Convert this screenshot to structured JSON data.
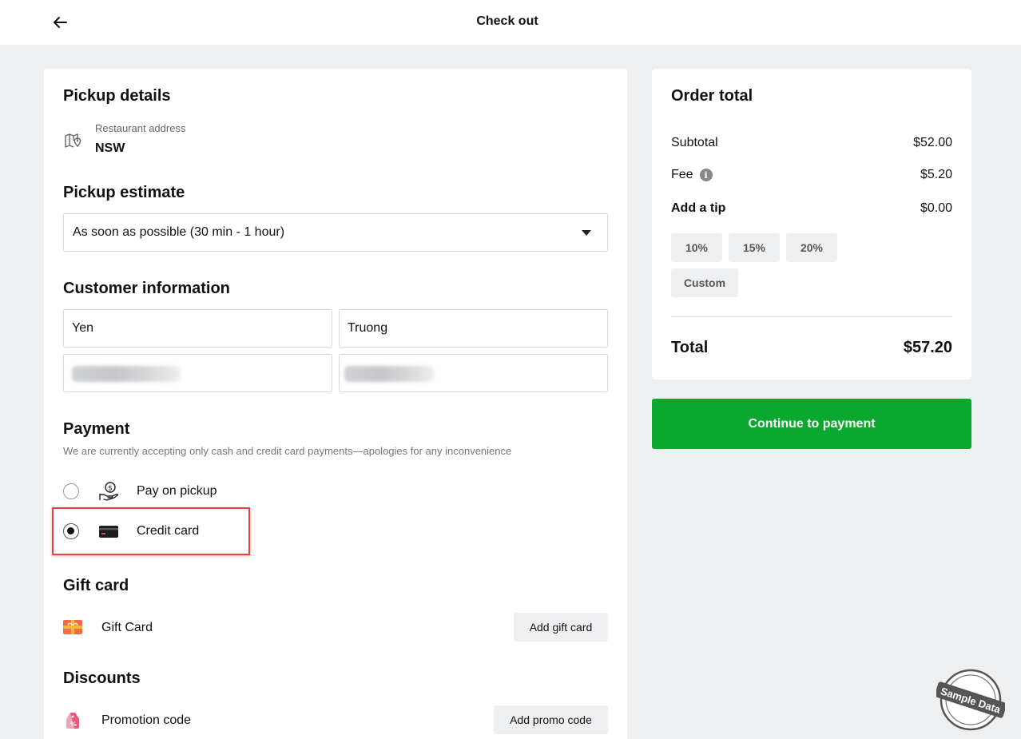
{
  "header": {
    "title": "Check out",
    "back_icon": "arrow-left-icon"
  },
  "pickup_details": {
    "heading": "Pickup details",
    "address_label": "Restaurant address",
    "address_value": "NSW",
    "icon": "map-pin-icon"
  },
  "pickup_estimate": {
    "heading": "Pickup estimate",
    "selected": "As soon as possible (30 min - 1 hour)"
  },
  "customer": {
    "heading": "Customer information",
    "first_name": "Yen",
    "last_name": "Truong"
  },
  "payment": {
    "heading": "Payment",
    "note": "We are currently accepting only cash and credit card payments—apologies for any inconvenience",
    "options": [
      {
        "label": "Pay on pickup",
        "icon": "cash-hand-icon",
        "selected": false
      },
      {
        "label": "Credit card",
        "icon": "credit-card-icon",
        "selected": true
      }
    ]
  },
  "gift_card": {
    "heading": "Gift card",
    "label": "Gift Card",
    "button": "Add gift card",
    "icon": "gift-card-icon"
  },
  "discounts": {
    "heading": "Discounts",
    "label": "Promotion code",
    "button": "Add promo code",
    "icon": "promo-tag-icon"
  },
  "order_total": {
    "heading": "Order total",
    "subtotal_label": "Subtotal",
    "subtotal_value": "$52.00",
    "fee_label": "Fee",
    "fee_value": "$5.20",
    "tip_label": "Add a tip",
    "tip_value": "$0.00",
    "tip_options": [
      "10%",
      "15%",
      "20%",
      "Custom"
    ],
    "total_label": "Total",
    "total_value": "$57.20"
  },
  "cta": {
    "label": "Continue to payment"
  },
  "watermark": "Sample Data",
  "colors": {
    "accent": "#0ba830",
    "highlight": "#e0463f",
    "background": "#eeeff1"
  }
}
